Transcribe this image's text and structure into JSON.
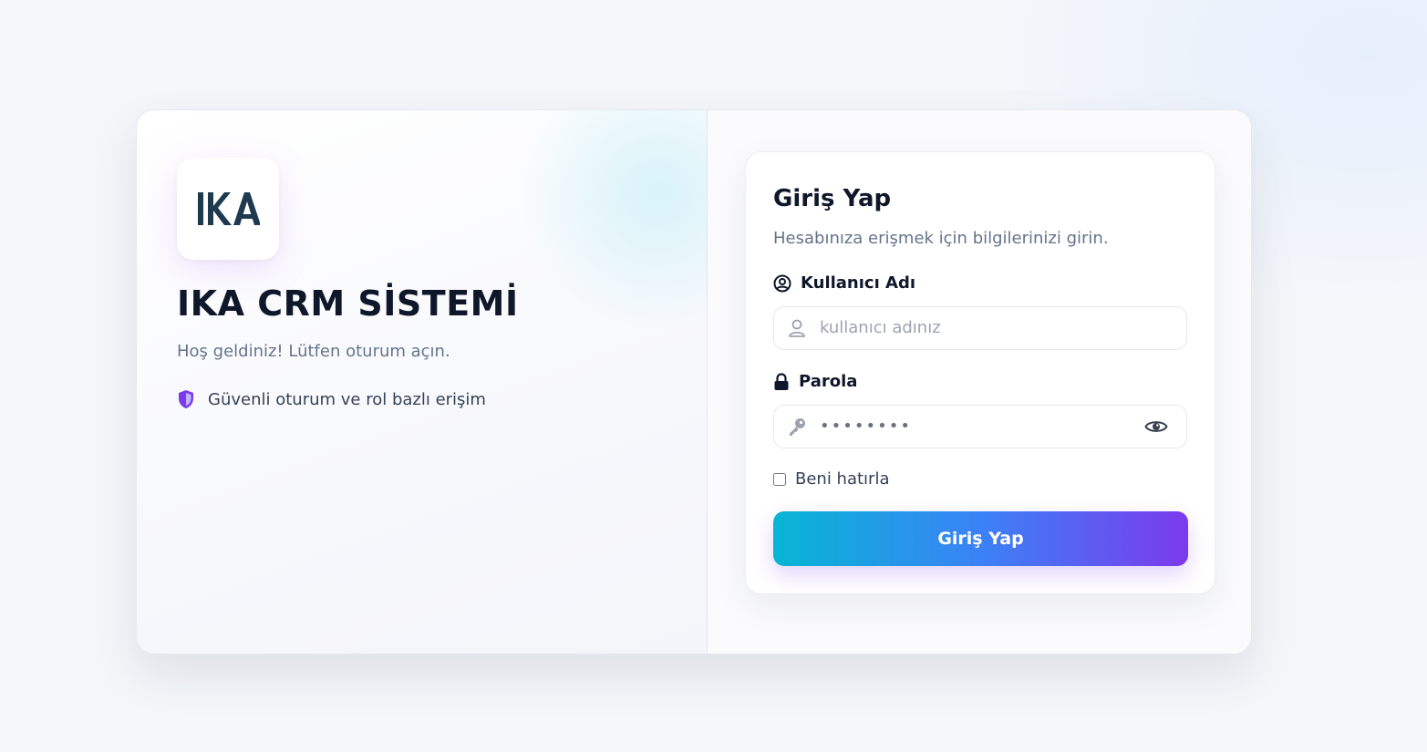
{
  "brand": {
    "logo_text": "IKA",
    "title": "IKA CRM SİSTEMİ",
    "subtitle": "Hoş geldiniz! Lütfen oturum açın.",
    "feature_text": "Güvenli oturum ve rol bazlı erişim",
    "feature_icon": "shield-icon",
    "logo_color": "#1e3a4f",
    "accent_color": "#7c3aed"
  },
  "login": {
    "title": "Giriş Yap",
    "subtitle": "Hesabınıza erişmek için bilgilerinizi girin.",
    "username_label": "Kullanıcı Adı",
    "username_label_icon": "user-circle-icon",
    "username_placeholder": "kullanıcı adınız",
    "username_value": "",
    "username_input_icon": "user-icon",
    "password_label": "Parola",
    "password_label_icon": "lock-icon",
    "password_value": "••••••••",
    "password_input_icon": "key-icon",
    "toggle_visibility_icon": "eye-icon",
    "remember_label": "Beni hatırla",
    "remember_checked": false,
    "submit_label": "Giriş Yap",
    "button_gradient": [
      "#06b6d4",
      "#3b82f6",
      "#7c3aed"
    ]
  }
}
